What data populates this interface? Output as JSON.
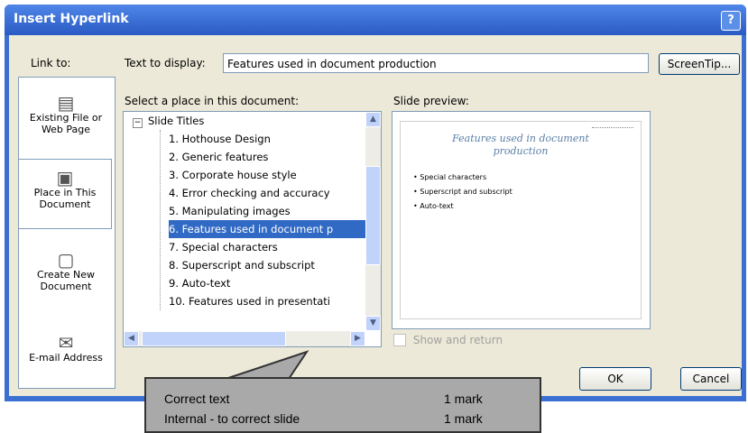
{
  "window": {
    "title": "Insert Hyperlink",
    "help": "?"
  },
  "link_to": {
    "label": "Link to:",
    "items": [
      {
        "label": "Existing File or Web Page",
        "icon": "file-globe-icon"
      },
      {
        "label": "Place in This Document",
        "icon": "document-place-icon"
      },
      {
        "label": "Create New Document",
        "icon": "new-document-icon"
      },
      {
        "label": "E-mail Address",
        "icon": "email-icon"
      }
    ]
  },
  "text_to_display": {
    "label": "Text to display:",
    "value": "Features used in document production"
  },
  "screentip_button": "ScreenTip...",
  "select_place": {
    "label": "Select a place in this document:",
    "root": "Slide Titles",
    "items": [
      "1. Hothouse Design",
      "2. Generic features",
      "3. Corporate house style",
      "4. Error checking and accuracy",
      "5. Manipulating images",
      "6. Features used in document p",
      "7. Special characters",
      "8. Superscript and subscript",
      "9. Auto-text",
      "10. Features used in presentati"
    ],
    "selected_index": 5
  },
  "slide_preview": {
    "label": "Slide preview:",
    "title": "Features used in document production",
    "bullets": [
      "Special characters",
      "Superscript and subscript",
      "Auto-text"
    ]
  },
  "show_and_return": "Show and return",
  "buttons": {
    "ok": "OK",
    "cancel": "Cancel"
  },
  "callout": {
    "rows": [
      {
        "text": "Correct text",
        "marks": "1 mark"
      },
      {
        "text": "Internal - to correct slide",
        "marks": "1 mark"
      }
    ]
  }
}
